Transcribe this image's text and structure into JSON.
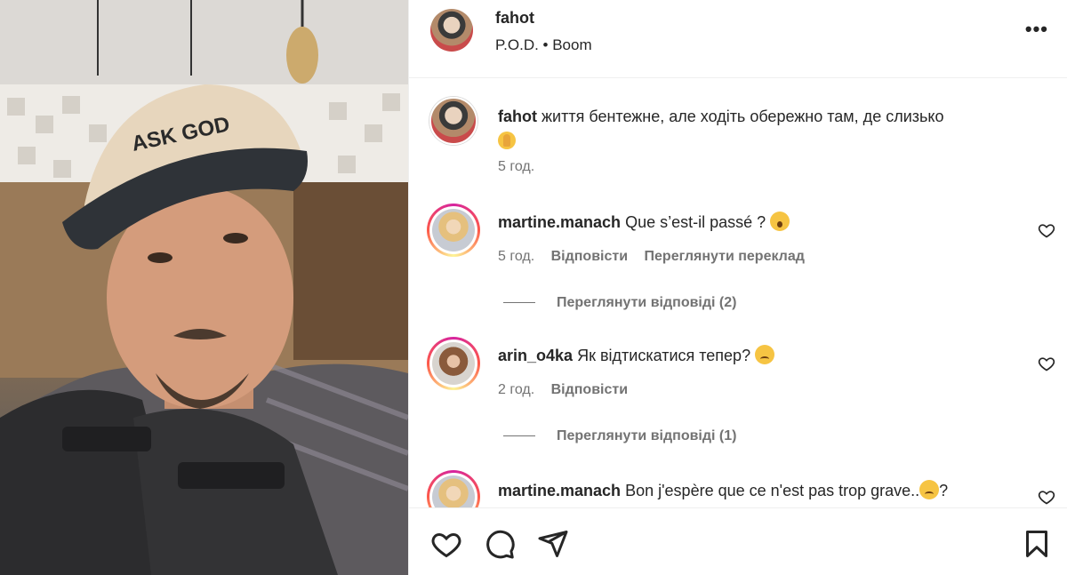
{
  "post": {
    "username": "fahot",
    "music": "P.O.D. • Boom",
    "more_icon": "more-horizontal-icon",
    "photo_hat_text": "ASK GOD"
  },
  "caption": {
    "username": "fahot",
    "text": "життя бентежне, але ходіть обережно там, де слизько",
    "emoji": "🙌",
    "time": "5 год."
  },
  "comments": [
    {
      "username": "martine.manach",
      "text": "Que s’est-il passé ?",
      "emoji": "😮",
      "time": "5 год.",
      "reply_label": "Відповісти",
      "translate_label": "Переглянути переклад",
      "view_replies": "Переглянути відповіді (2)"
    },
    {
      "username": "arin_o4ka",
      "text": "Як відтискатися тепер?",
      "emoji": "😥",
      "time": "2 год.",
      "reply_label": "Відповісти",
      "view_replies": "Переглянути відповіді (1)"
    },
    {
      "username": "martine.manach",
      "text": "Bon j'espère que ce n'est pas trop grave..",
      "emoji": "😥",
      "text_after": "?"
    }
  ],
  "actions": {
    "like_icon": "heart-icon",
    "comment_icon": "comment-icon",
    "share_icon": "send-icon",
    "save_icon": "bookmark-icon"
  },
  "colors": {
    "text": "#262626",
    "secondary": "#737373",
    "border": "#efefef"
  }
}
